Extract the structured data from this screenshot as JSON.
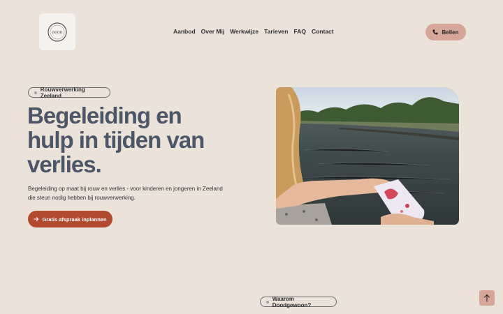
{
  "nav": {
    "items": [
      "Aanbod",
      "Over Mij",
      "Werkwijze",
      "Tarieven",
      "FAQ",
      "Contact"
    ]
  },
  "header": {
    "call_label": "Bellen",
    "call_icon": "phone-icon",
    "logo_icon": "logo-emblem"
  },
  "hero": {
    "badge": "Rouwverwerking Zeeland",
    "headline": "Begeleiding en hulp in tijden van verlies.",
    "subtext": "Begeleiding op maat bij rouw en verlies - voor kinderen en jongeren in Zeeland die steun nodig hebben bij rouwverwerking.",
    "cta_label": "Gratis afspraak inplannen",
    "cta_icon": "arrow-right-icon",
    "photo_icon": "hero-photo"
  },
  "section": {
    "badge": "Waarom Doodgewoon?"
  },
  "back_to_top_icon": "arrow-up-icon",
  "colors": {
    "background": "#ebe3da",
    "accent": "#b24a2f",
    "soft_accent": "#d7a69a",
    "headline": "#4d5568"
  }
}
